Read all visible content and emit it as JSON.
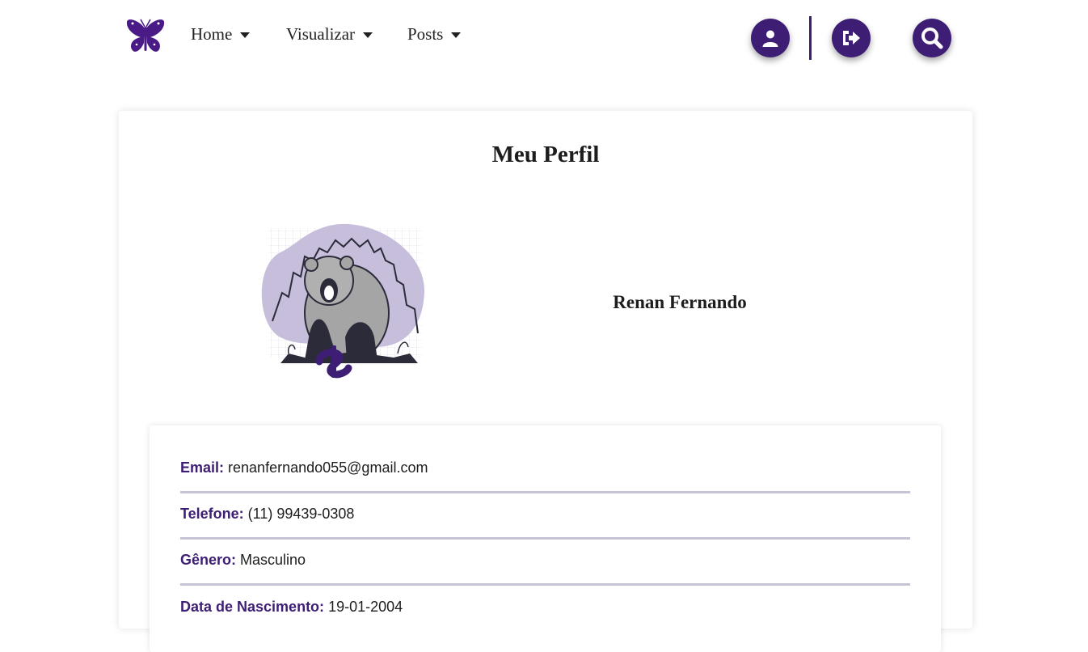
{
  "nav": {
    "logo_icon": "butterfly-icon",
    "items": [
      {
        "label": "Home"
      },
      {
        "label": "Visualizar"
      },
      {
        "label": "Posts"
      }
    ],
    "buttons": [
      {
        "icon": "user-icon"
      },
      {
        "icon": "logout-icon"
      },
      {
        "icon": "search-icon"
      }
    ],
    "accent_color": "#3d1e74"
  },
  "profile": {
    "title": "Meu Perfil",
    "avatar_icon": "bear-illustration",
    "name": "Renan Fernando",
    "fields": [
      {
        "label": "Email:",
        "value": "renanfernando055@gmail.com"
      },
      {
        "label": "Telefone:",
        "value": "(11) 99439-0308"
      },
      {
        "label": "Gênero:",
        "value": "Masculino"
      },
      {
        "label": "Data de Nascimento:",
        "value": "19-01-2004"
      }
    ]
  }
}
